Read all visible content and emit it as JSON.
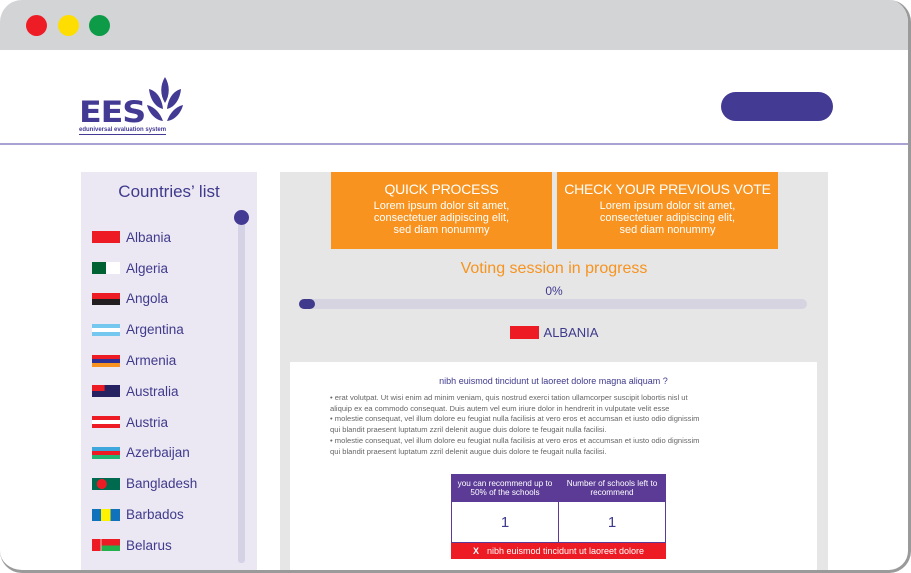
{
  "window": {
    "controls": [
      "close",
      "minimize",
      "maximize"
    ]
  },
  "header": {
    "logo_text": "EES",
    "logo_subtitle": "eduniversal evaluation system",
    "button_label": ""
  },
  "sidebar": {
    "title": "Countries’ list",
    "countries": [
      {
        "name": "Albania",
        "flag": "albania"
      },
      {
        "name": "Algeria",
        "flag": "algeria"
      },
      {
        "name": "Angola",
        "flag": "angola"
      },
      {
        "name": "Argentina",
        "flag": "argentina"
      },
      {
        "name": "Armenia",
        "flag": "armenia"
      },
      {
        "name": "Australia",
        "flag": "australia"
      },
      {
        "name": "Austria",
        "flag": "austria"
      },
      {
        "name": "Azerbaijan",
        "flag": "azerbaijan"
      },
      {
        "name": "Bangladesh",
        "flag": "bangladesh"
      },
      {
        "name": "Barbados",
        "flag": "barbados"
      },
      {
        "name": "Belarus",
        "flag": "belarus"
      }
    ]
  },
  "cards": {
    "quick": {
      "title": "QUICK PROCESS",
      "line1": "Lorem ipsum dolor sit amet,",
      "line2": "consectetuer adipiscing elit,",
      "line3": "sed diam nonummy"
    },
    "check": {
      "title": "CHECK YOUR PREVIOUS VOTE",
      "line1": "Lorem ipsum dolor sit amet,",
      "line2": "consectetuer adipiscing elit,",
      "line3": "sed diam nonummy"
    }
  },
  "session": {
    "title": "Voting session in progress",
    "progress_label": "0%",
    "progress_value": 0
  },
  "selected_country": {
    "name": "ALBANIA"
  },
  "content": {
    "question": "nibh euismod tincidunt ut laoreet dolore magna aliquam ?",
    "lines": [
      "• erat volutpat. Ut wisi enim ad minim veniam, quis nostrud exerci tation ullamcorper suscipit lobortis nisl ut",
      "aliquip ex ea commodo consequat. Duis autem vel eum iriure dolor in hendrerit in vulputate velit esse",
      "• molestie consequat, vel illum dolore eu feugiat nulla facilisis at vero eros et accumsan et iusto odio dignissim",
      "qui blandit praesent luptatum zzril delenit augue duis dolore te feugait nulla facilisi.",
      "• molestie consequat, vel illum dolore eu feugiat nulla facilisis at vero eros et accumsan et iusto odio dignissim",
      "qui blandit praesent luptatum zzril delenit augue duis dolore te feugait nulla facilisi."
    ],
    "table": {
      "headers": [
        "you can recommend up to 50% of the schools",
        "Number of schools left to recommend"
      ],
      "values": [
        "1",
        "1"
      ]
    },
    "error": {
      "icon": "X",
      "message": "nibh euismod tincidunt ut laoreet dolore"
    }
  },
  "colors": {
    "brand": "#433a94",
    "accent_orange": "#f7931e",
    "table_header": "#5b3b96",
    "error": "#ed1c24"
  }
}
